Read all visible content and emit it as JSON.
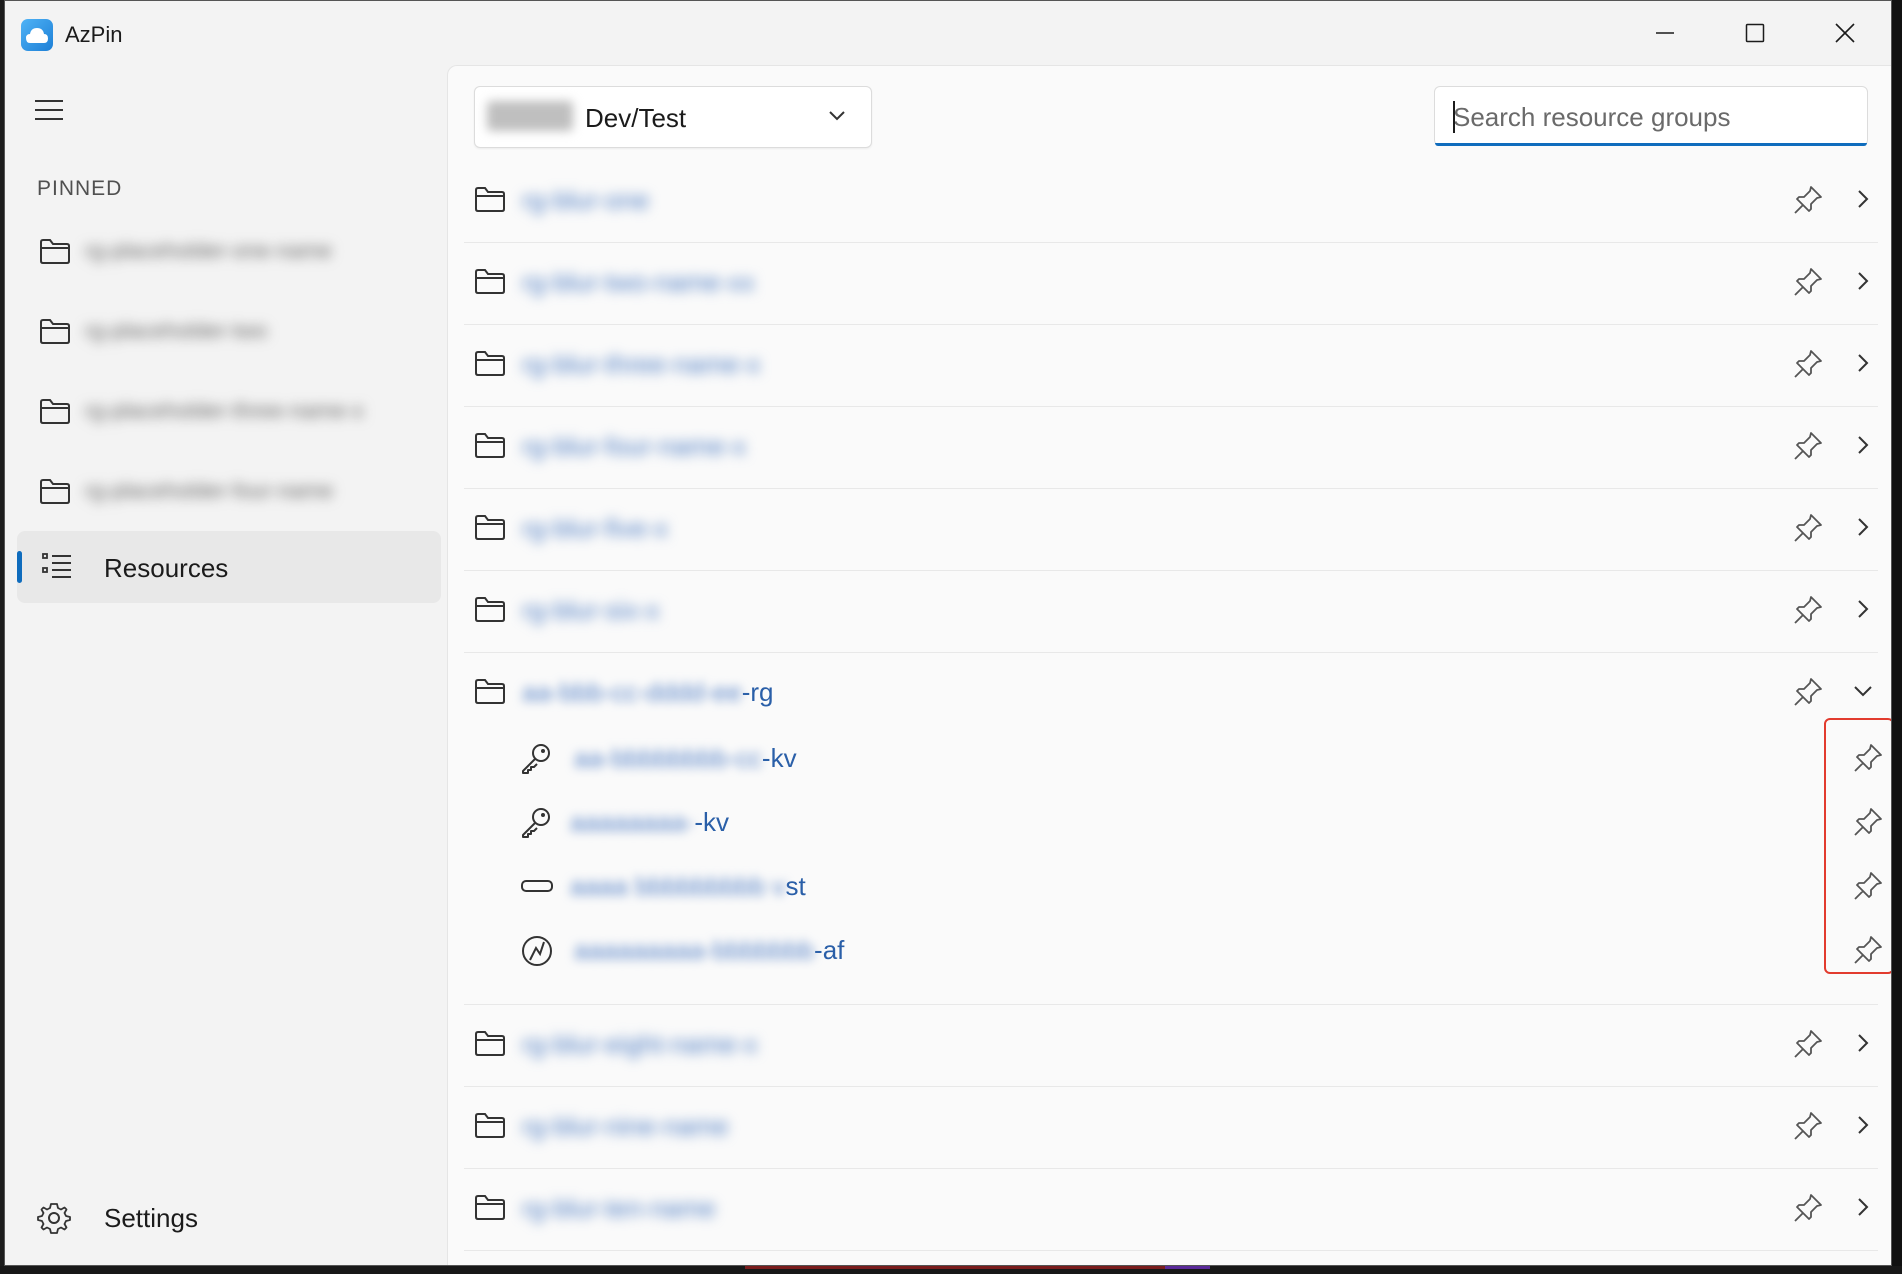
{
  "window": {
    "title": "AzPin"
  },
  "sidebar": {
    "pinned_label": "PINNED",
    "pinned_items": [
      {
        "label": "rg-placeholder-one-name"
      },
      {
        "label": "rg-placeholder-two"
      },
      {
        "label": "rg-placeholder-three-name-x"
      },
      {
        "label": "rg-placeholder-four-name"
      }
    ],
    "resources_label": "Resources",
    "settings_label": "Settings"
  },
  "header": {
    "subscription_value": "Dev/Test",
    "search_placeholder": "Search resource groups"
  },
  "resource_groups": [
    {
      "name": "rg-blur-one"
    },
    {
      "name": "rg-blur-two-name-xx"
    },
    {
      "name": "rg-blur-three-name-x"
    },
    {
      "name": "rg-blur-four-name-x"
    },
    {
      "name": "rg-blur-five-x"
    },
    {
      "name": "rg-blur-six-x"
    },
    {
      "name_suffix": "-rg",
      "resources": [
        {
          "suffix": "-kv",
          "icon": "key-icon"
        },
        {
          "suffix": "-kv",
          "icon": "key-icon"
        },
        {
          "suffix": "st",
          "icon": "storage-icon"
        },
        {
          "suffix": "-af",
          "icon": "function-app-icon"
        }
      ]
    },
    {
      "name": "rg-blur-eight-name-x"
    },
    {
      "name": "rg-blur-nine-name"
    },
    {
      "name": "rg-blur-ten-name"
    }
  ],
  "colors": {
    "accent": "#0f6cbd",
    "link": "#2a5fa8",
    "highlight": "#e23b2e"
  }
}
